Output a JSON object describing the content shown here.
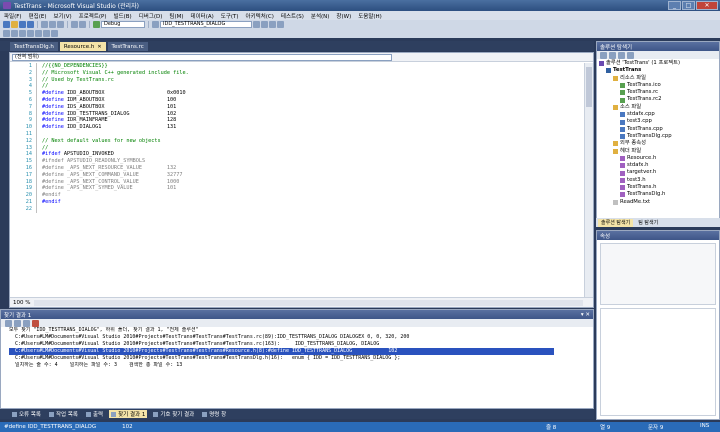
{
  "window": {
    "title": "TestTrans - Microsoft Visual Studio (관리자)",
    "btn_min": "_",
    "btn_max": "□",
    "btn_close": "✕"
  },
  "menu": [
    "파일(F)",
    "편집(E)",
    "보기(V)",
    "프로젝트(P)",
    "빌드(B)",
    "디버그(D)",
    "팀(M)",
    "데이터(A)",
    "도구(T)",
    "아키텍처(C)",
    "테스트(S)",
    "분석(N)",
    "창(W)",
    "도움말(H)"
  ],
  "toolbar": {
    "config": "Debug",
    "find_combo": "IDD_TESTTRANS_DIALOG"
  },
  "doc_tabs": [
    {
      "label": "TestTransDlg.h",
      "active": false
    },
    {
      "label": "Resource.h",
      "active": true
    },
    {
      "label": "TestTrans.rc",
      "active": false
    }
  ],
  "doc_tab_close": "✕",
  "editor": {
    "nav_combo": "(전역 범위)",
    "zoom": "100 %",
    "lines": [
      {
        "n": "1",
        "t": "//{{NO_DEPENDENCIES}}",
        "c": "cm"
      },
      {
        "n": "2",
        "t": "// Microsoft Visual C++ generated include file.",
        "c": "cm"
      },
      {
        "n": "3",
        "t": "// Used by TestTrans.rc",
        "c": "cm"
      },
      {
        "n": "4",
        "t": "//",
        "c": "cm"
      },
      {
        "n": "5",
        "t": "#define IDD_ABOUTBOX                    0x0010",
        "c": "def"
      },
      {
        "n": "6",
        "t": "#define IDM_ABOUTBOX                    100",
        "c": "def"
      },
      {
        "n": "7",
        "t": "#define IDS_ABOUTBOX                    101",
        "c": "def"
      },
      {
        "n": "8",
        "t": "#define IDD_TESTTRANS_DIALOG            102",
        "c": "def"
      },
      {
        "n": "9",
        "t": "#define IDR_MAINFRAME                   128",
        "c": "def"
      },
      {
        "n": "10",
        "t": "#define IDD_DIALOG1                     131",
        "c": "def"
      },
      {
        "n": "11",
        "t": "",
        "c": "tx"
      },
      {
        "n": "12",
        "t": "// Next default values for new objects",
        "c": "cm"
      },
      {
        "n": "13",
        "t": "//",
        "c": "cm"
      },
      {
        "n": "14",
        "t": "#ifdef APSTUDIO_INVOKED",
        "c": "def"
      },
      {
        "n": "15",
        "t": "#ifndef APSTUDIO_READONLY_SYMBOLS",
        "c": "gr"
      },
      {
        "n": "16",
        "t": "#define _APS_NEXT_RESOURCE_VALUE        132",
        "c": "gr"
      },
      {
        "n": "17",
        "t": "#define _APS_NEXT_COMMAND_VALUE         32777",
        "c": "gr"
      },
      {
        "n": "18",
        "t": "#define _APS_NEXT_CONTROL_VALUE         1000",
        "c": "gr"
      },
      {
        "n": "19",
        "t": "#define _APS_NEXT_SYMED_VALUE           101",
        "c": "gr"
      },
      {
        "n": "20",
        "t": "#endif",
        "c": "gr"
      },
      {
        "n": "21",
        "t": "#endif",
        "c": "def"
      },
      {
        "n": "22",
        "t": "",
        "c": "tx"
      }
    ]
  },
  "find": {
    "title": "찾기 결과 1",
    "controls": "▾ ✕",
    "lines": [
      {
        "t": "모두 찾기 \"IDD_TESTTRANS_DIALOG\", 하위 폴더, 찾기 결과 1, \"전체 솔루션\"",
        "sel": false
      },
      {
        "t": "  C:#Users#LM#Documents#Visual Studio 2010#Projects#TestTrans#TestTrans#TestTrans.rc(89):IDD_TESTTRANS_DIALOG DIALOGEX 0, 0, 320, 200",
        "sel": false
      },
      {
        "t": "  C:#Users#LM#Documents#Visual Studio 2010#Projects#TestTrans#TestTrans#TestTrans.rc(163):     IDD_TESTTRANS_DIALOG, DIALOG",
        "sel": false
      },
      {
        "t": "  C:#Users#LM#Documents#Visual Studio 2010#Projects#TestTrans#TestTrans#Resource.h(8):#define IDD_TESTTRANS_DIALOG            102",
        "sel": true
      },
      {
        "t": "  C:#Users#LM#Documents#Visual Studio 2010#Projects#TestTrans#TestTrans#TestTransDlg.h(16):   enum { IDD = IDD_TESTTRANS_DIALOG };",
        "sel": false
      },
      {
        "t": "  일치하는 줄 수: 4    일치하는 파일 수: 3    검색한 총 파일 수: 13",
        "sel": false
      }
    ]
  },
  "bottom_tabs": [
    {
      "label": "오류 목록",
      "active": false
    },
    {
      "label": "작업 목록",
      "active": false
    },
    {
      "label": "출력",
      "active": false
    },
    {
      "label": "찾기 결과 1",
      "active": true
    },
    {
      "label": "기호 찾기 결과",
      "active": false
    },
    {
      "label": "명령 창",
      "active": false
    }
  ],
  "solution": {
    "title": "솔루션 탐색기",
    "root": "솔루션 'TestTrans' (1 프로젝트)",
    "tree": [
      {
        "label": "TestTrans",
        "depth": 1,
        "icon": "fproj",
        "bold": true
      },
      {
        "label": "리소스 파일",
        "depth": 2,
        "icon": "fold"
      },
      {
        "label": "TestTrans.ico",
        "depth": 3,
        "icon": "fres"
      },
      {
        "label": "TestTrans.rc",
        "depth": 3,
        "icon": "fres"
      },
      {
        "label": "TestTrans.rc2",
        "depth": 3,
        "icon": "fres"
      },
      {
        "label": "소스 파일",
        "depth": 2,
        "icon": "fold"
      },
      {
        "label": "stdafx.cpp",
        "depth": 3,
        "icon": "fcpp"
      },
      {
        "label": "test3.cpp",
        "depth": 3,
        "icon": "fcpp"
      },
      {
        "label": "TestTrans.cpp",
        "depth": 3,
        "icon": "fcpp"
      },
      {
        "label": "TestTransDlg.cpp",
        "depth": 3,
        "icon": "fcpp"
      },
      {
        "label": "외부 종속성",
        "depth": 2,
        "icon": "fold"
      },
      {
        "label": "헤더 파일",
        "depth": 2,
        "icon": "fold"
      },
      {
        "label": "Resource.h",
        "depth": 3,
        "icon": "fh"
      },
      {
        "label": "stdafx.h",
        "depth": 3,
        "icon": "fh"
      },
      {
        "label": "targetver.h",
        "depth": 3,
        "icon": "fh"
      },
      {
        "label": "test3.h",
        "depth": 3,
        "icon": "fh"
      },
      {
        "label": "TestTrans.h",
        "depth": 3,
        "icon": "fh"
      },
      {
        "label": "TestTransDlg.h",
        "depth": 3,
        "icon": "fh"
      },
      {
        "label": "ReadMe.txt",
        "depth": 2,
        "icon": "ftxt"
      }
    ],
    "tabs": [
      {
        "label": "솔루션 탐색기",
        "active": true
      },
      {
        "label": "팀 탐색기",
        "active": false
      }
    ]
  },
  "properties": {
    "title": "속성"
  },
  "status": {
    "left": "#define IDD_TESTTRANS_DIALOG",
    "left2": "102",
    "line": "줄 8",
    "col": "열 9",
    "ch": "문자 9",
    "mode": "INS"
  },
  "colors": {
    "selection": "#2a52be",
    "active_tab": "#f4e4a8",
    "status": "#2a6bb8"
  }
}
